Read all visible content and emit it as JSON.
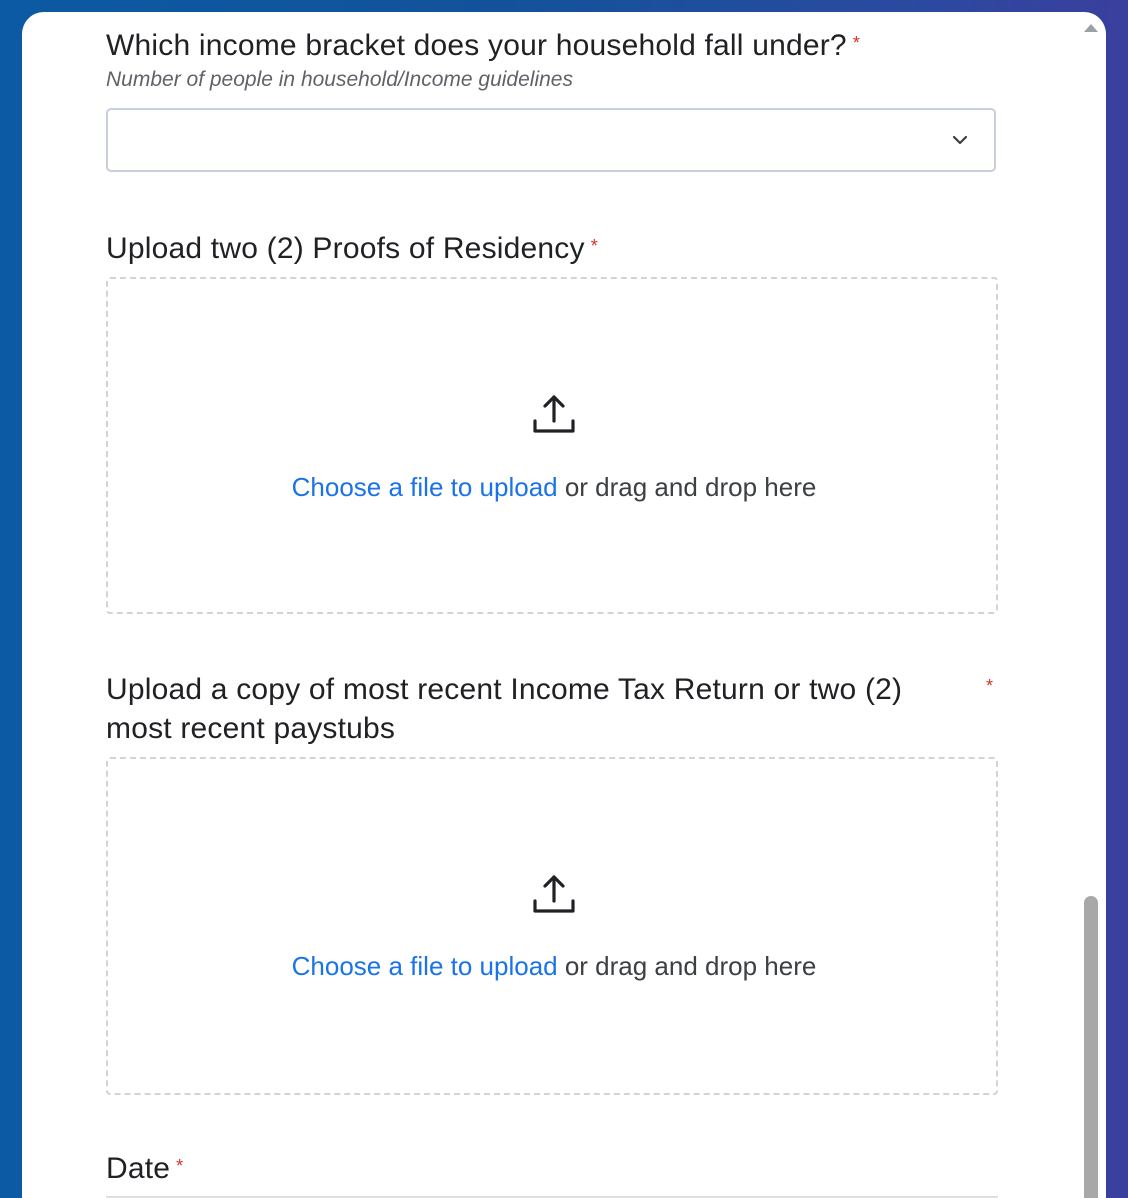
{
  "form": {
    "income_question": {
      "title": "Which income bracket does your household fall under?",
      "required_mark": "*",
      "subtitle": "Number of people in household/Income guidelines",
      "selected_value": ""
    },
    "residency_upload": {
      "title": "Upload two (2) Proofs of Residency",
      "required_mark": "*",
      "link_text": "Choose a file to upload",
      "rest_text": " or drag and drop here"
    },
    "tax_upload": {
      "title": "Upload a copy of most recent Income Tax Return or two (2) most recent paystubs",
      "required_mark": "*",
      "link_text": "Choose a file to upload",
      "rest_text": " or drag and drop here"
    },
    "date_question": {
      "title": "Date",
      "required_mark": "*"
    }
  },
  "colors": {
    "accent_link": "#1a73e8",
    "required": "#d93025",
    "background_left": "#0b5aa3",
    "background_right": "#3a3f9e"
  },
  "icons": {
    "dropdown": "chevron-down-icon",
    "upload": "upload-icon",
    "scroll": "scroll-up-arrow-icon"
  }
}
